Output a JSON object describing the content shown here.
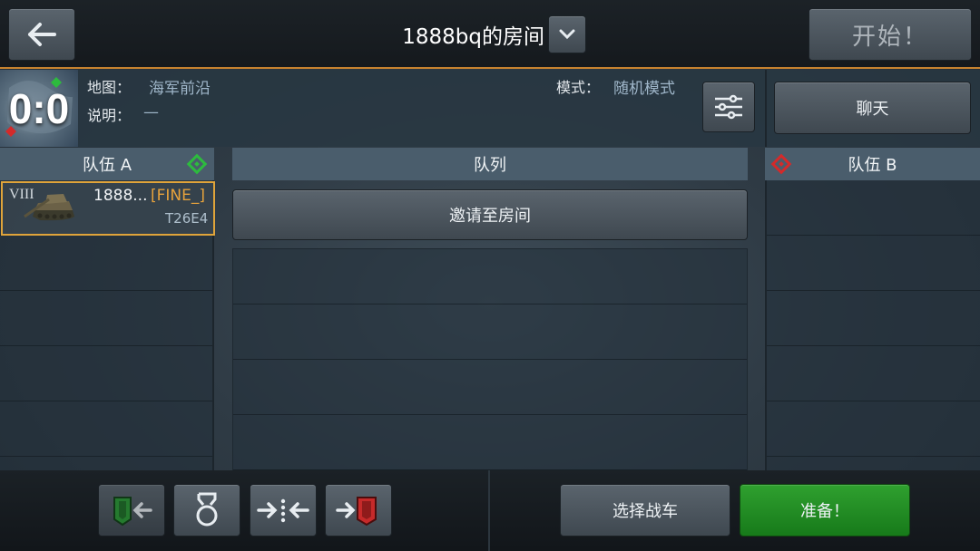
{
  "header": {
    "room_title": "1888bq的房间",
    "start_label": "开始！"
  },
  "info": {
    "score": "0:0",
    "map_label": "地图：",
    "map_value": "海军前沿",
    "desc_label": "说明：",
    "desc_value": "—",
    "mode_label": "模式：",
    "mode_value": "随机模式",
    "chat_label": "聊天"
  },
  "teams": {
    "team_a": "队伍 A",
    "queue": "队列",
    "team_b": "队伍 B",
    "invite_label": "邀请至房间"
  },
  "player": {
    "tier": "VIII",
    "name": "1888...",
    "clan": "[FINE_]",
    "tank": "T26E4"
  },
  "footer": {
    "select_tank_label": "选择战车",
    "ready_label": "准备！"
  },
  "colors": {
    "accent": "#c8832f",
    "team_a": "#2dbb3e",
    "team_b": "#d42a2a",
    "ready": "#2fa02f",
    "clan": "#e6a23c"
  },
  "icons": [
    "back-arrow-icon",
    "chevron-down-icon",
    "settings-sliders-icon",
    "team-a-diamond-icon",
    "team-b-diamond-icon",
    "tank-icon",
    "move-to-team-a-icon",
    "medal-icon",
    "merge-icon",
    "move-to-team-b-icon"
  ]
}
